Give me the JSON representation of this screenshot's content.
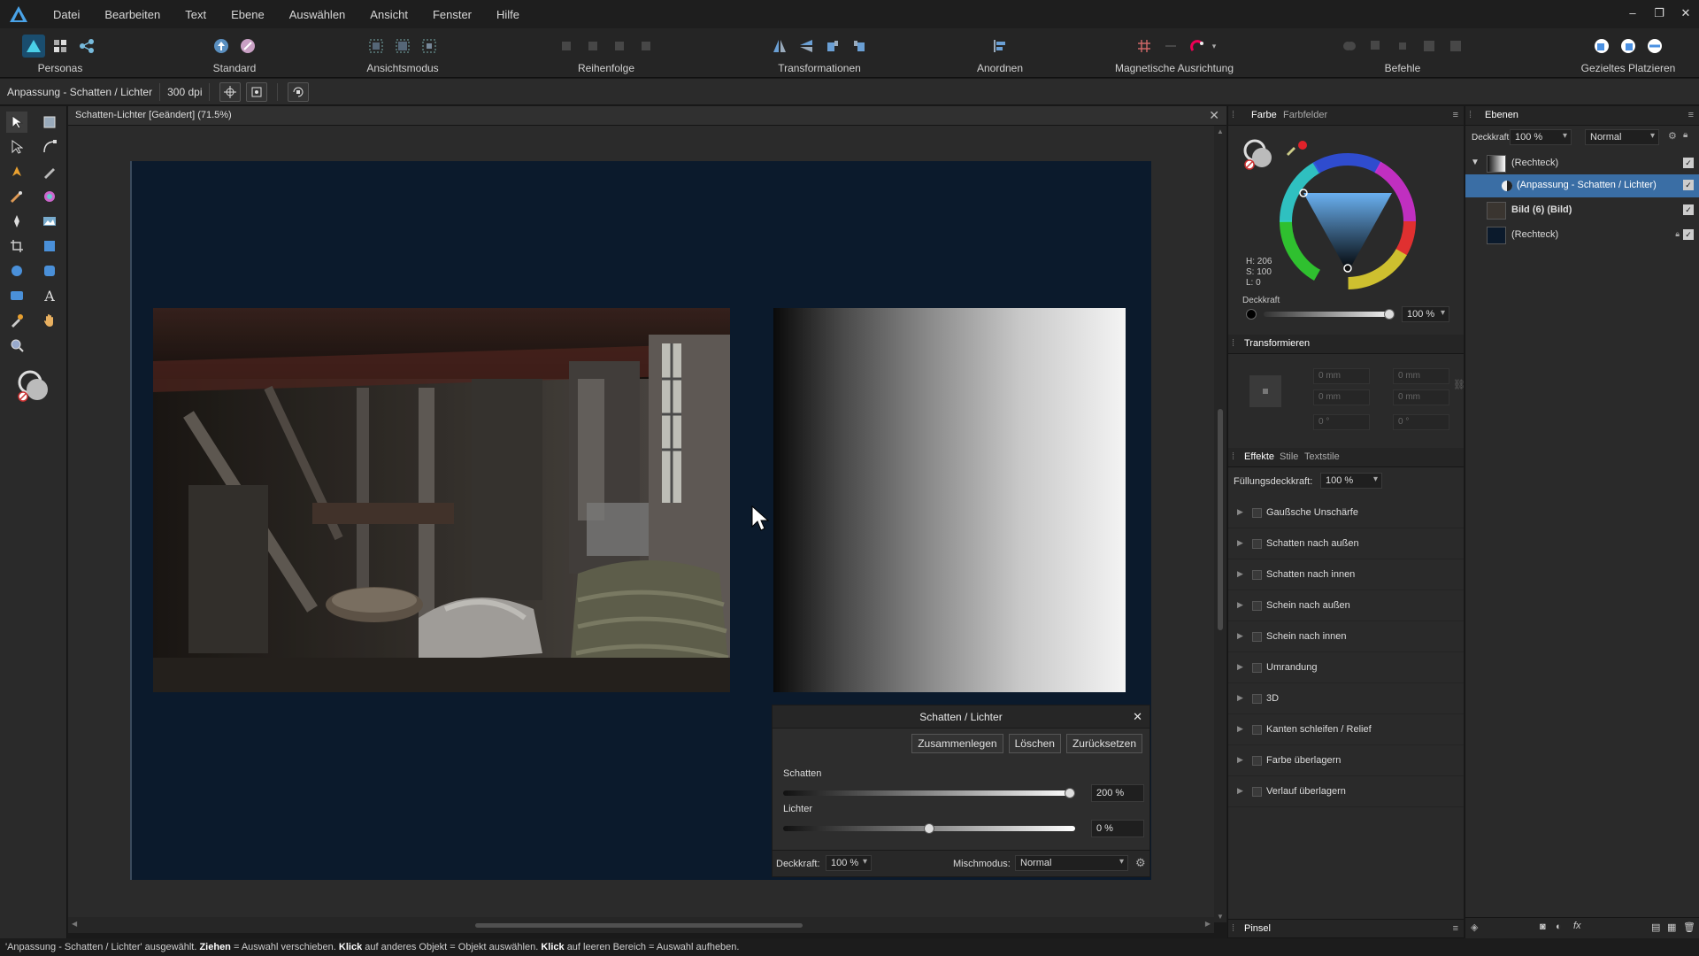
{
  "menubar": {
    "items": [
      "Datei",
      "Bearbeiten",
      "Text",
      "Ebene",
      "Auswählen",
      "Ansicht",
      "Fenster",
      "Hilfe"
    ]
  },
  "toolbar": {
    "groups": [
      {
        "label": "Personas"
      },
      {
        "label": "Standard"
      },
      {
        "label": "Ansichtsmodus"
      },
      {
        "label": "Reihenfolge"
      },
      {
        "label": "Transformationen"
      },
      {
        "label": "Anordnen"
      },
      {
        "label": "Magnetische Ausrichtung"
      },
      {
        "label": "Befehle"
      },
      {
        "label": "Gezieltes Platzieren"
      }
    ]
  },
  "context": {
    "title": "Anpassung - Schatten / Lichter",
    "dpi": "300 dpi"
  },
  "document": {
    "tab_title": "Schatten-Lichter [Geändert] (71.5%)"
  },
  "dialog": {
    "title": "Schatten / Lichter",
    "merge_label": "Zusammenlegen",
    "delete_label": "Löschen",
    "reset_label": "Zurücksetzen",
    "shadows_label": "Schatten",
    "shadows_value": "200 %",
    "shadows_level": 1.0,
    "highlights_label": "Lichter",
    "highlights_value": "0 %",
    "highlights_level": 0.5,
    "opacity_label": "Deckkraft:",
    "opacity_value": "100 %",
    "blend_label": "Mischmodus:",
    "blend_value": "Normal"
  },
  "color_panel": {
    "tab_color": "Farbe",
    "tab_swatches": "Farbfelder",
    "h": "H: 206",
    "s": "S: 100",
    "l": "L: 0",
    "opacity_label": "Deckkraft",
    "opacity_value": "100 %"
  },
  "transform_panel": {
    "title": "Transformieren",
    "x": "0 mm",
    "y": "0 mm",
    "w": "0 mm",
    "h": "0 mm",
    "r": "0 °",
    "s": "0 °"
  },
  "effects_panel": {
    "tab_effects": "Effekte",
    "tab_styles": "Stile",
    "tab_textstyles": "Textstile",
    "fill_opacity_label": "Füllungsdeckkraft:",
    "fill_opacity_value": "100 %",
    "effects": [
      "Gaußsche Unschärfe",
      "Schatten nach außen",
      "Schatten nach innen",
      "Schein nach außen",
      "Schein nach innen",
      "Umrandung",
      "3D",
      "Kanten schleifen / Relief",
      "Farbe überlagern",
      "Verlauf überlagern"
    ]
  },
  "brush_panel": {
    "title": "Pinsel"
  },
  "layers_panel": {
    "title": "Ebenen",
    "opacity_label": "Deckkraft:",
    "opacity_value": "100 %",
    "blend_value": "Normal",
    "layers": [
      {
        "name": "(Rechteck)"
      },
      {
        "name": "(Anpassung - Schatten / Lichter)"
      },
      {
        "name": "Bild (6) (Bild)"
      },
      {
        "name": "(Rechteck)"
      }
    ]
  },
  "status": {
    "p1": "'Anpassung - Schatten / Lichter' ausgewählt.",
    "b1": "Ziehen",
    "p2": "= Auswahl verschieben.",
    "b2": "Klick",
    "p3": "auf anderes Objekt = Objekt auswählen.",
    "b3": "Klick",
    "p4": "auf leeren Bereich = Auswahl aufheben."
  },
  "colors": {
    "accent": "#3a6ea5",
    "artboard": "#0b1a2c",
    "selected_layer": "#3a6ea5"
  }
}
